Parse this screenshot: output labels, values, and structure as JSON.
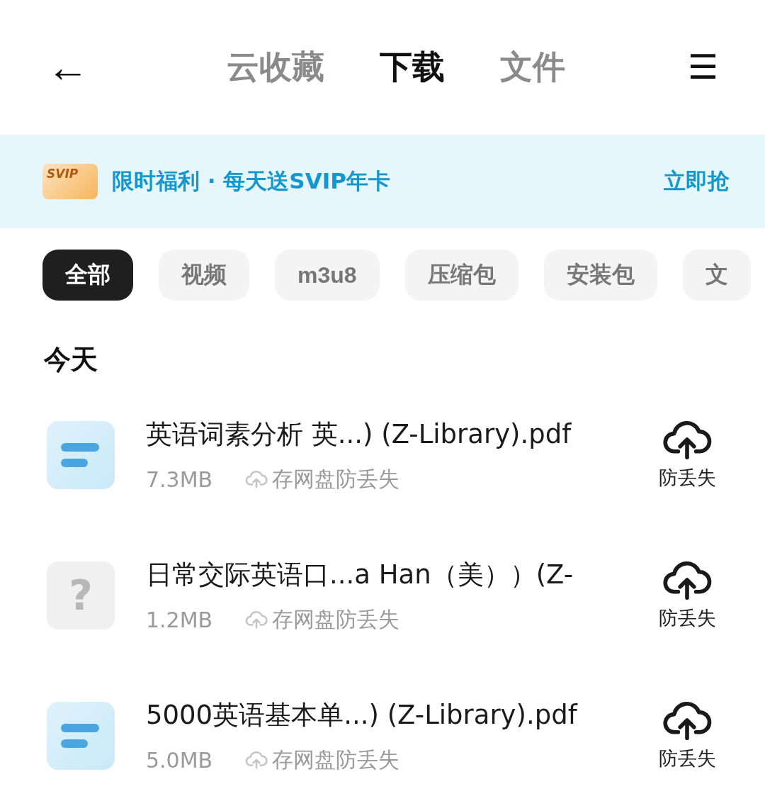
{
  "nav": {
    "back": "←",
    "menu": "☰",
    "tabs": [
      {
        "label": "云收藏",
        "selected": false
      },
      {
        "label": "下载",
        "selected": true
      },
      {
        "label": "文件",
        "selected": false
      }
    ]
  },
  "banner": {
    "badge": "SVIP",
    "text": "限时福利 · 每天送SVIP年卡",
    "action": "立即抢"
  },
  "filters": [
    {
      "label": "全部",
      "selected": true
    },
    {
      "label": "视频",
      "selected": false
    },
    {
      "label": "m3u8",
      "selected": false
    },
    {
      "label": "压缩包",
      "selected": false
    },
    {
      "label": "安装包",
      "selected": false
    },
    {
      "label": "文",
      "selected": false
    }
  ],
  "section": "今天",
  "files": [
    {
      "kind": "doc",
      "name": "英语词素分析 英...) (Z-Library).pdf",
      "size": "7.3MB",
      "hint": "存网盘防丢失",
      "action": "防丢失"
    },
    {
      "kind": "unknown",
      "glyph": "?",
      "name": "日常交际英语口...a Han（美））(Z-",
      "size": "1.2MB",
      "hint": "存网盘防丢失",
      "action": "防丢失"
    },
    {
      "kind": "doc",
      "name": "5000英语基本单...) (Z-Library).pdf",
      "size": "5.0MB",
      "hint": "存网盘防丢失",
      "action": "防丢失"
    }
  ]
}
